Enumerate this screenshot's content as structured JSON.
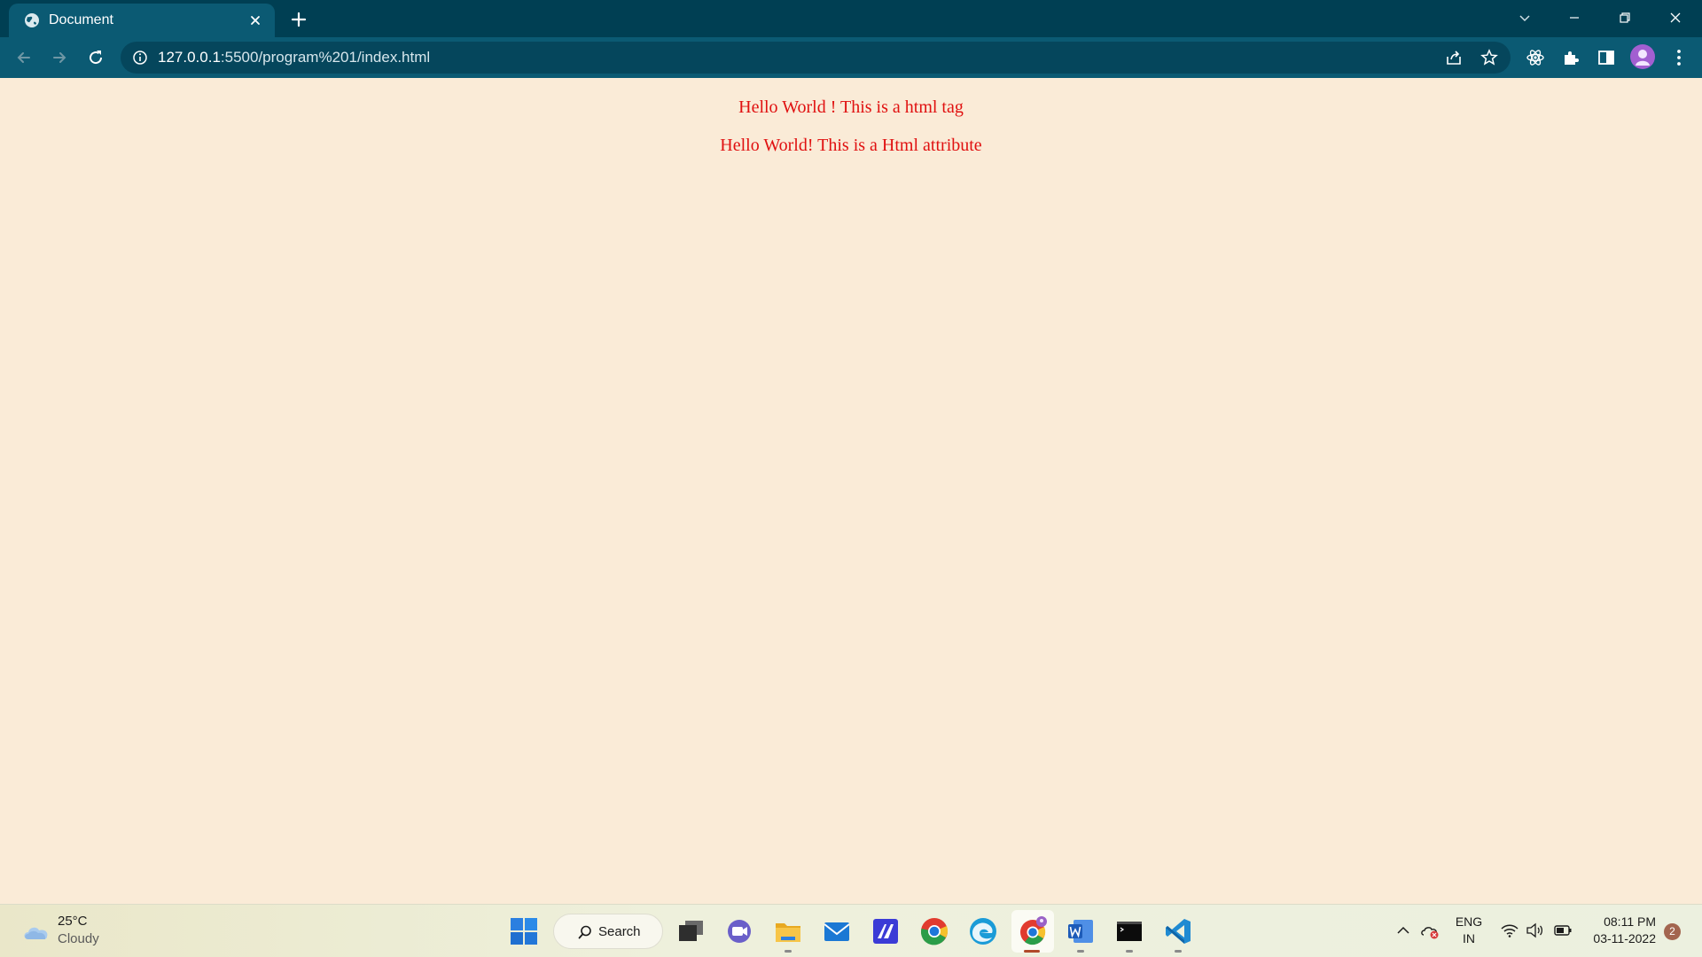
{
  "browser": {
    "tab_title": "Document",
    "url_host": "127.0.0.1",
    "url_path": ":5500/program%201/index.html"
  },
  "page": {
    "paragraphs": [
      "Hello World ! This is a html tag",
      "Hello World! This is a Html attribute"
    ],
    "text_color": "#e01010",
    "background_color": "#faebd7"
  },
  "taskbar": {
    "weather_temp": "25°C",
    "weather_condition": "Cloudy",
    "search_label": "Search",
    "language_line1": "ENG",
    "language_line2": "IN",
    "time": "08:11 PM",
    "date": "03-11-2022",
    "notification_count": "2"
  },
  "colors": {
    "titlebar": "#003f53",
    "toolbar": "#0b5a73",
    "taskbar": "#eef0dc"
  }
}
